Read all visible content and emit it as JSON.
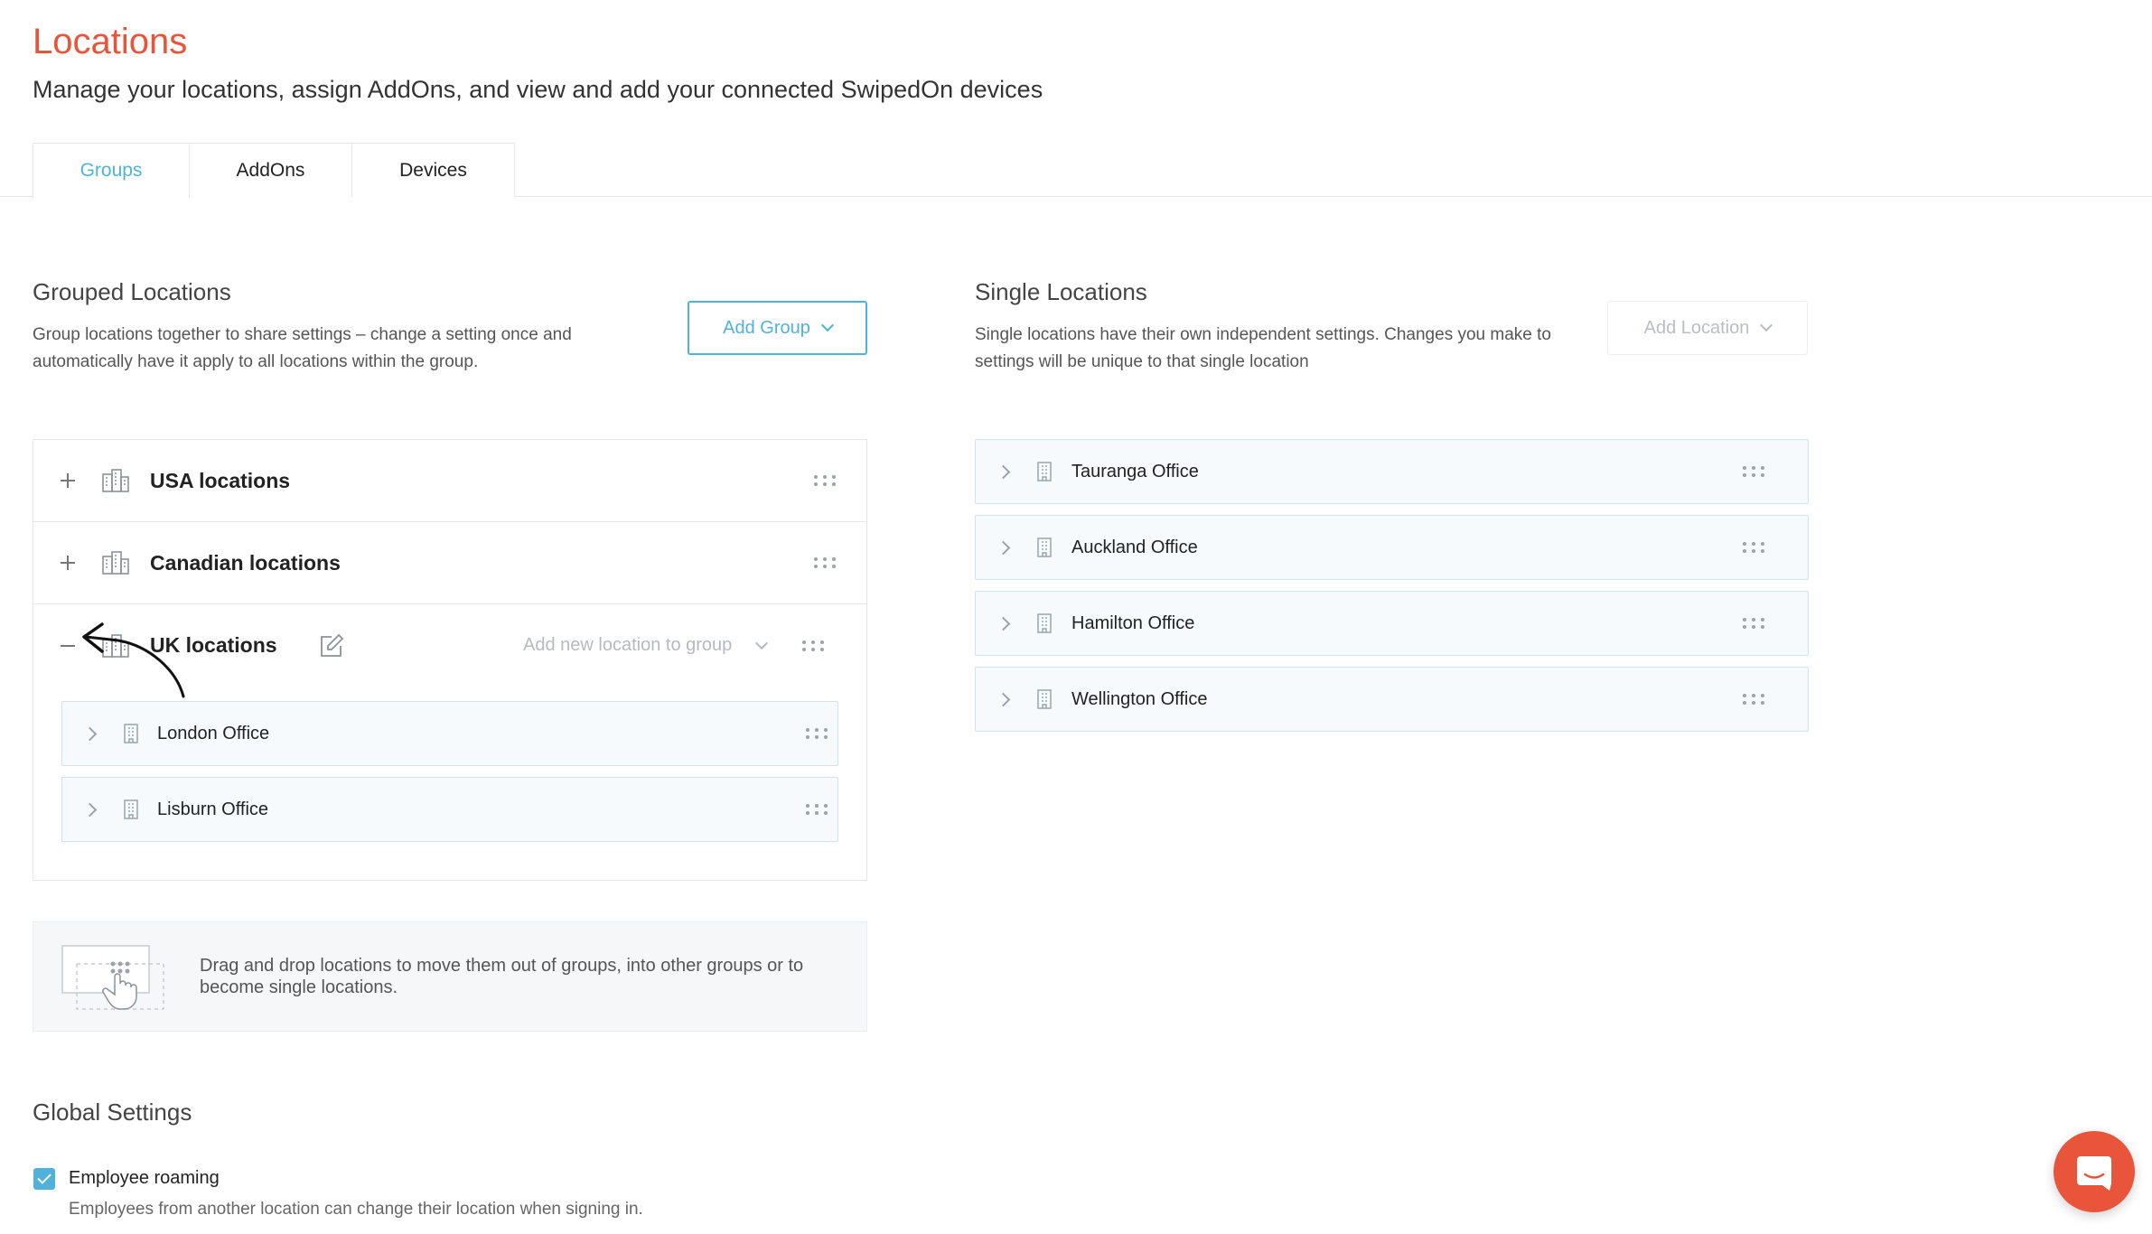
{
  "header": {
    "title": "Locations",
    "subtitle": "Manage your locations, assign AddOns, and view and add your connected SwipedOn devices"
  },
  "tabs": [
    {
      "label": "Groups",
      "active": true
    },
    {
      "label": "AddOns",
      "active": false
    },
    {
      "label": "Devices",
      "active": false
    }
  ],
  "grouped": {
    "title": "Grouped Locations",
    "description_line1": "Group locations together to share settings – change a setting once and",
    "description_line2": "automatically have it apply to all locations within the group.",
    "add_button": "Add Group",
    "groups": [
      {
        "name": "USA locations",
        "expanded": false
      },
      {
        "name": "Canadian locations",
        "expanded": false
      },
      {
        "name": "UK locations",
        "expanded": true
      }
    ],
    "add_to_group_placeholder": "Add new location to group",
    "uk_locations": [
      {
        "name": "London Office"
      },
      {
        "name": "Lisburn Office"
      }
    ]
  },
  "single": {
    "title": "Single Locations",
    "description_line1": "Single locations have their own independent settings. Changes you make to",
    "description_line2": "settings will be unique to that single location",
    "add_button": "Add Location",
    "locations": [
      {
        "name": "Tauranga Office"
      },
      {
        "name": "Auckland Office"
      },
      {
        "name": "Hamilton Office"
      },
      {
        "name": "Wellington Office"
      }
    ]
  },
  "drag_info": {
    "text": "Drag and drop locations to move them out of groups, into other groups or to become single locations."
  },
  "global_settings": {
    "title": "Global Settings",
    "employee_roaming": {
      "label": "Employee roaming",
      "checked": true,
      "description": "Employees from another location can change their location when signing in."
    }
  },
  "colors": {
    "brand": "#e8553a",
    "accent": "#4fb3d9"
  },
  "icons": [
    "edit-icon",
    "building-icon",
    "group-building-icon",
    "drag-handle-icon",
    "chat-icon",
    "arrow-annotation-icon"
  ]
}
